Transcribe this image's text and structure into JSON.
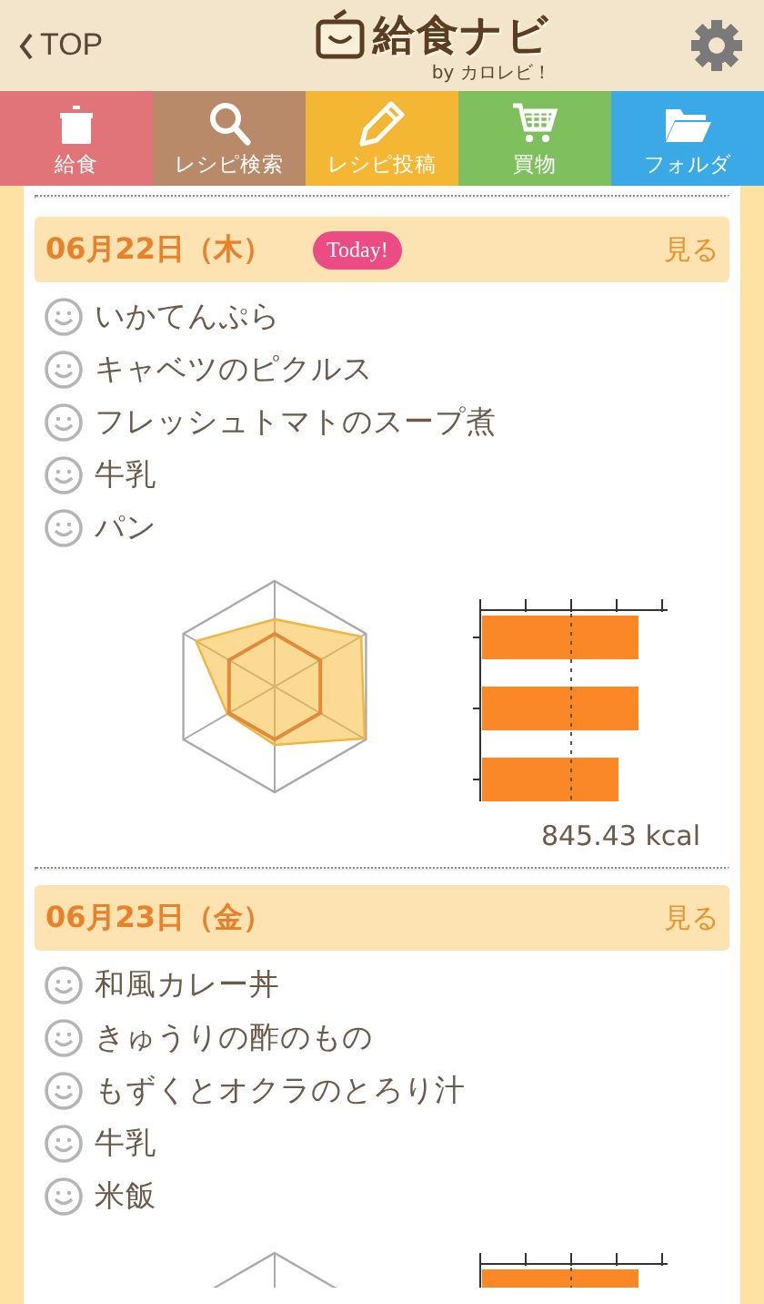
{
  "header": {
    "back": "TOP",
    "logo": "給食ナビ",
    "byline": "by カロレビ！"
  },
  "tabs": [
    {
      "label": "給食",
      "color": "#e07478"
    },
    {
      "label": "レシピ検索",
      "color": "#b98a69"
    },
    {
      "label": "レシピ投稿",
      "color": "#f3b733"
    },
    {
      "label": "買物",
      "color": "#7fbf5e"
    },
    {
      "label": "フォルダ",
      "color": "#3aa9e6"
    }
  ],
  "days": [
    {
      "date": "06月22日（木）",
      "today": true,
      "today_label": "Today!",
      "view": "見る",
      "menu": [
        "いかてんぷら",
        "キャベツのピクルス",
        "フレッシュトマトのスープ煮",
        "牛乳",
        "パン"
      ],
      "kcal": "845.43 kcal"
    },
    {
      "date": "06月23日（金）",
      "today": false,
      "view": "見る",
      "menu": [
        "和風カレー丼",
        "きゅうりの酢のもの",
        "もずくとオクラのとろり汁",
        "牛乳",
        "米飯"
      ]
    }
  ]
}
